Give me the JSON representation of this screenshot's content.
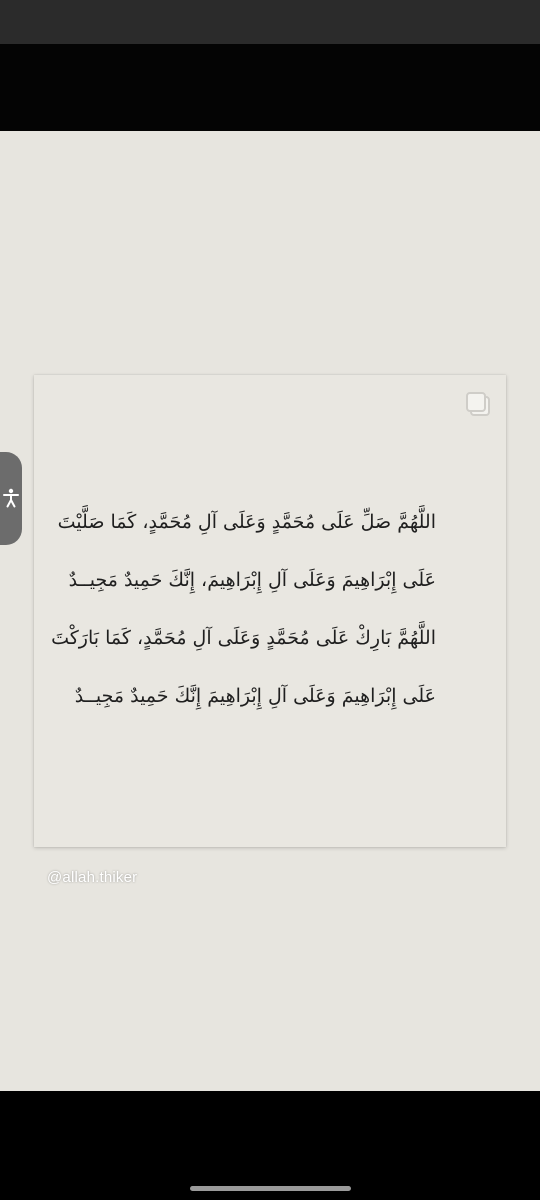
{
  "post": {
    "dua_lines": [
      "اللَّهُمَّ صَلِّ عَلَى مُحَمَّدٍ وَعَلَى آلِ مُحَمَّدٍ، كَمَا صَلَّيْتَ",
      "عَلَى إِبْرَاهِيمَ وَعَلَى آلِ إِبْرَاهِيمَ، إِنَّكَ حَمِيدٌ مَجِيــدٌ",
      "اللَّهُمَّ بَارِكْ عَلَى مُحَمَّدٍ وَعَلَى آلِ مُحَمَّدٍ، كَمَا بَارَكْتَ",
      "عَلَى إِبْرَاهِيمَ وَعَلَى آلِ إِبْرَاهِيمَ إِنَّكَ حَمِيدٌ مَجِيــدٌ"
    ],
    "watermark": "@allah.thiker",
    "card_icon": "multiple-images-icon"
  },
  "overlay": {
    "accessibility_icon": "accessibility-icon"
  },
  "colors": {
    "page_background": "#e7e5df",
    "card_background": "#e9e7e1",
    "text": "#1f1f1f",
    "accessibility_tab": "#6c6c6c"
  }
}
